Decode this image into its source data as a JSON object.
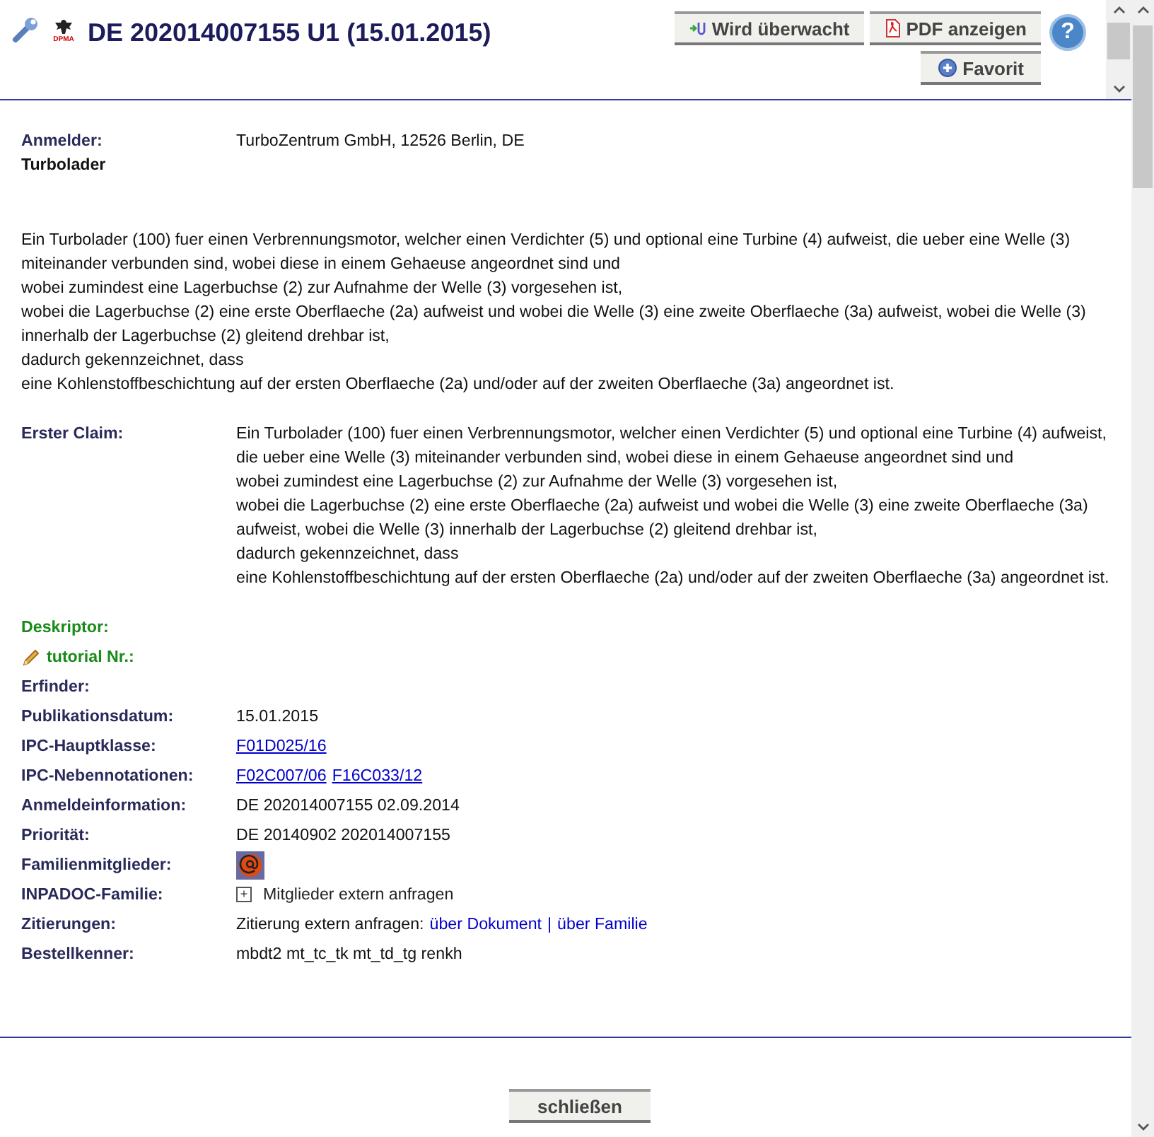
{
  "header": {
    "title": "DE 202014007155 U1 (15.01.2015)",
    "office_mark": "DPMA",
    "buttons": [
      {
        "label": "Wird überwacht",
        "kind": "watch"
      },
      {
        "label": "PDF anzeigen",
        "kind": "pdf"
      },
      {
        "label": "Favorit",
        "kind": "favorite"
      }
    ],
    "help": "?"
  },
  "applicant": {
    "label": "Anmelder:",
    "value": "TurboZentrum GmbH, 12526 Berlin, DE"
  },
  "doc_title": "Turbolader",
  "abstract": [
    "Ein Turbolader (100) fuer einen Verbrennungsmotor, welcher einen Verdichter (5) und optional eine Turbine (4) aufweist, die ueber eine Welle (3) miteinander verbunden sind, wobei diese in einem Gehaeuse angeordnet sind und",
    "wobei zumindest eine Lagerbuchse (2) zur Aufnahme der Welle (3) vorgesehen ist,",
    "wobei die Lagerbuchse (2) eine erste Oberflaeche (2a) aufweist und wobei die Welle (3) eine zweite Oberflaeche (3a) aufweist, wobei die Welle (3) innerhalb der Lagerbuchse (2) gleitend drehbar ist,",
    "dadurch gekennzeichnet, dass",
    "eine Kohlenstoffbeschichtung auf der ersten Oberflaeche (2a) und/oder auf der zweiten Oberflaeche (3a) angeordnet ist."
  ],
  "first_claim": {
    "label": "Erster Claim:",
    "lines": [
      "Ein Turbolader (100) fuer einen Verbrennungsmotor, welcher einen Verdichter (5) und optional eine Turbine (4) aufweist, die ueber eine Welle (3) miteinander verbunden sind, wobei diese in einem Gehaeuse angeordnet sind und",
      "wobei zumindest eine Lagerbuchse (2) zur Aufnahme der Welle (3) vorgesehen ist,",
      "wobei die Lagerbuchse (2) eine erste Oberflaeche (2a) aufweist und wobei die Welle (3) eine zweite Oberflaeche (3a) aufweist, wobei die Welle (3) innerhalb der Lagerbuchse (2) gleitend drehbar ist,",
      "dadurch gekennzeichnet, dass",
      "eine Kohlenstoffbeschichtung auf der ersten Oberflaeche (2a) und/oder auf der zweiten Oberflaeche (3a) angeordnet ist."
    ]
  },
  "sections": [
    {
      "label": "Deskriptor:",
      "kind": "heading"
    },
    {
      "label": "tutorial Nr.:",
      "kind": "edit_heading"
    }
  ],
  "fields": [
    {
      "label": "Erfinder:",
      "kind": "text"
    },
    {
      "label": "Publikationsdatum:",
      "kind": "text",
      "value": "15.01.2015"
    },
    {
      "label": "IPC-Hauptklasse:",
      "kind": "links",
      "links": [
        "F01D025/16"
      ]
    },
    {
      "label": "IPC-Nebennotationen:",
      "kind": "links",
      "links": [
        "F02C007/06",
        "F16C033/12"
      ]
    },
    {
      "label": "Anmeldeinformation:",
      "kind": "text",
      "value": "DE 202014007155 02.09.2014"
    },
    {
      "label": "Priorität:",
      "kind": "text",
      "value": "DE 20140902 202014007155"
    },
    {
      "label": "Familienmitglieder:",
      "kind": "at_icon"
    },
    {
      "label": "INPADOC-Familie:",
      "kind": "expand",
      "value": "Mitglieder extern anfragen",
      "expand_sign": "+"
    },
    {
      "label": "Zitierungen:",
      "kind": "citation",
      "value": "Zitierung extern anfragen:",
      "links": [
        "über Dokument",
        "über Familie"
      ],
      "separator": "|"
    },
    {
      "label": "Bestellkenner:",
      "kind": "text",
      "value": "mbdt2 mt_tc_tk mt_td_tg renkh"
    }
  ],
  "close_button": "schließen"
}
